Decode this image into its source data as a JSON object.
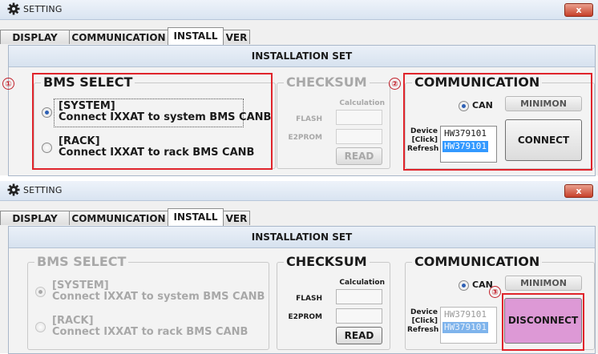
{
  "window": {
    "title": "SETTING",
    "close_label": "x"
  },
  "tabs": [
    "DISPLAY",
    "COMMUNICATION",
    "INSTALL",
    "VER"
  ],
  "section_title": "INSTALLATION SET",
  "bms_select": {
    "title": "BMS SELECT",
    "system_label": "[SYSTEM]",
    "system_desc": "Connect IXXAT to system BMS CANB",
    "rack_label": "[RACK]",
    "rack_desc": "Connect IXXAT to rack BMS CANB"
  },
  "checksum": {
    "title": "CHECKSUM",
    "calculation": "Calculation",
    "flash": "FLASH",
    "e2prom": "E2PROM",
    "read_label": "READ"
  },
  "communication": {
    "title": "COMMUNICATION",
    "can_label": "CAN",
    "minimon_label": "MINIMON",
    "device_label": "Device",
    "click_label": "[Click]",
    "refresh_label": "Refresh",
    "devices": [
      "HW379101",
      "HW379101"
    ],
    "connect_label": "CONNECT",
    "disconnect_label": "DISCONNECT"
  },
  "annotations": {
    "one": "①",
    "two": "②",
    "three": "③"
  },
  "colors": {
    "highlight_red": "#e0242b",
    "disconnect_bg": "#dd99d6",
    "selection": "#3399ff"
  }
}
